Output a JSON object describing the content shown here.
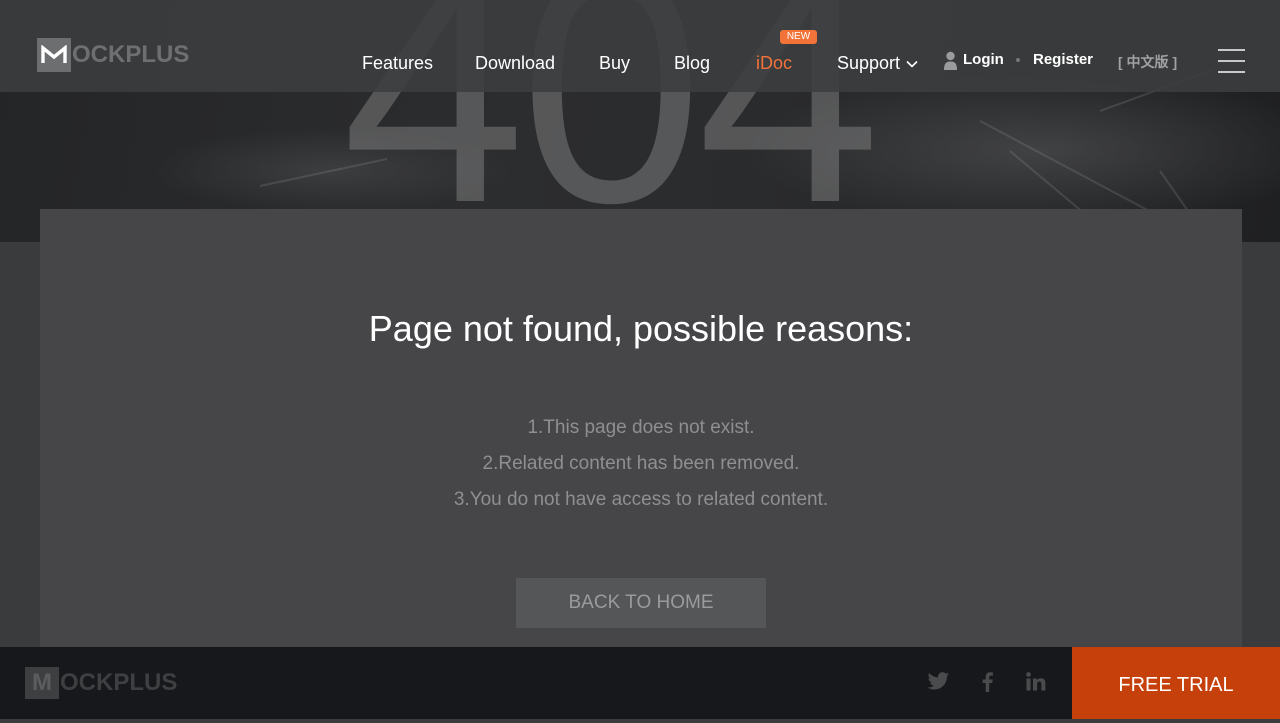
{
  "header": {
    "logo_text": "OCKPLUS",
    "logo_letter": "M",
    "nav": {
      "features": "Features",
      "download": "Download",
      "buy": "Buy",
      "blog": "Blog",
      "idoc": "iDoc",
      "idoc_badge": "NEW",
      "support": "Support"
    },
    "login": "Login",
    "register": "Register",
    "language": "[ 中文版 ]",
    "accent_color": "#f2733a"
  },
  "hero": {
    "error_code": "404"
  },
  "main": {
    "title": "Page not found, possible reasons:",
    "reasons": [
      "1.This page does not exist.",
      "2.Related content has been removed.",
      "3.You do not have access to related content."
    ],
    "back_button": "BACK TO HOME"
  },
  "footer": {
    "logo_text": "OCKPLUS",
    "logo_letter": "M",
    "social_icons": [
      "twitter-icon",
      "facebook-icon",
      "linkedin-icon"
    ],
    "free_trial": "FREE TRIAL",
    "free_trial_color": "#c6400b"
  }
}
